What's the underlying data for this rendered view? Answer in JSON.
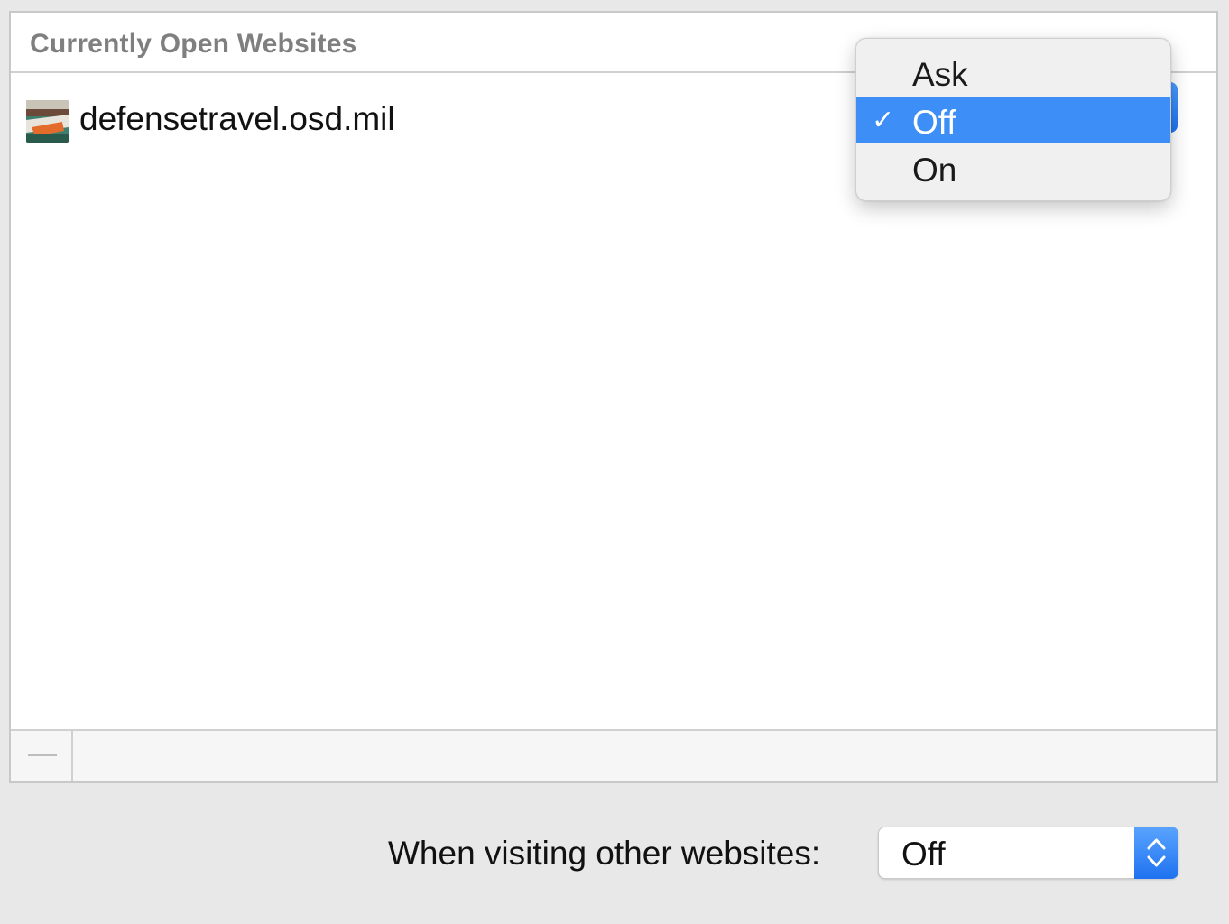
{
  "panel": {
    "title": "Currently Open Websites",
    "sites": [
      {
        "name": "defensetravel.osd.mil",
        "setting": "Off"
      }
    ],
    "footer": {
      "remove_label": "—"
    }
  },
  "popup_menu": {
    "options": [
      "Ask",
      "Off",
      "On"
    ],
    "selected": "Off",
    "check_glyph": "✓"
  },
  "other_websites": {
    "label": "When visiting other websites:",
    "value": "Off"
  },
  "icons": {
    "favicon": "defensetravel-favicon-icon",
    "stepper": "up-down-chevron-icon",
    "checkmark": "checkmark-icon"
  },
  "colors": {
    "accent": "#3d8ef6",
    "header_text": "#7f7f7f"
  }
}
